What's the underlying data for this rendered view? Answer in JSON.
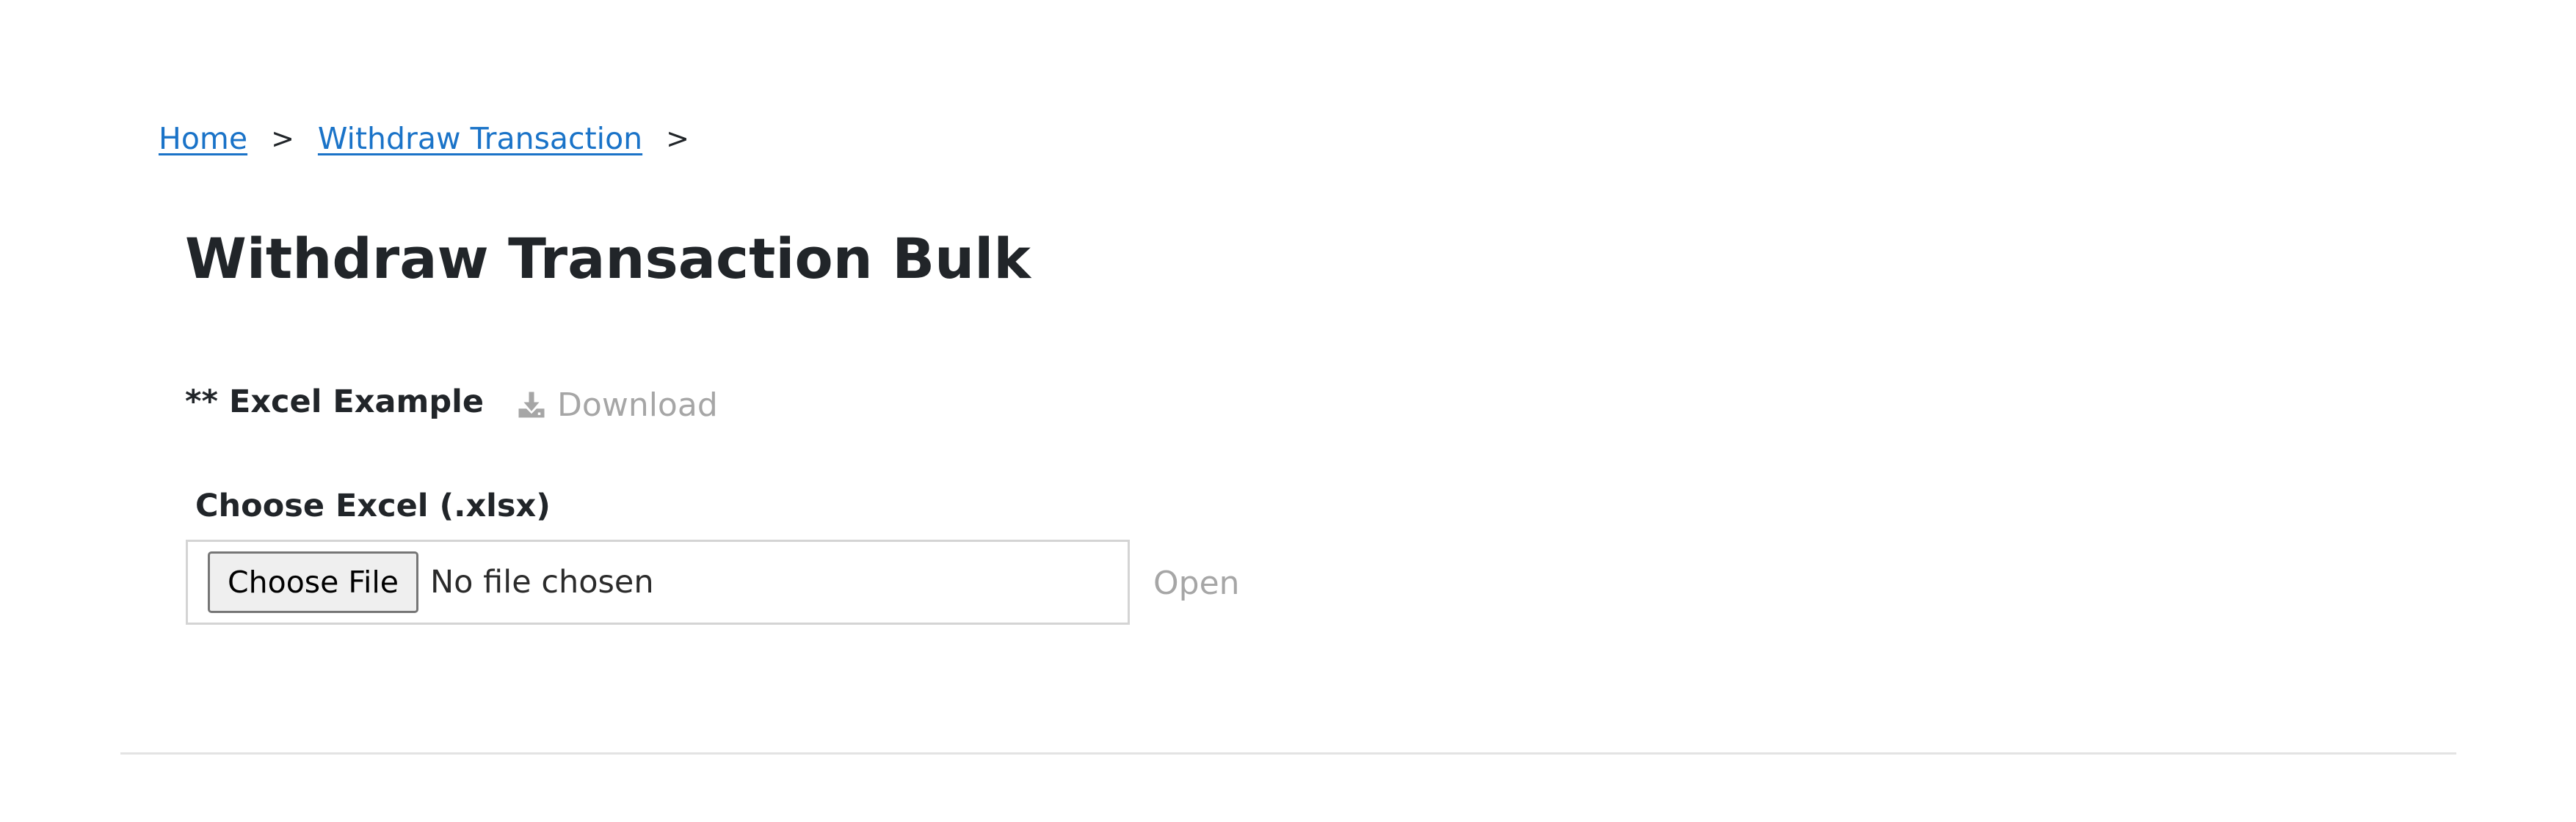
{
  "breadcrumb": {
    "items": [
      {
        "label": "Home"
      },
      {
        "label": "Withdraw Transaction"
      }
    ],
    "separator": ">"
  },
  "page": {
    "title": "Withdraw Transaction Bulk"
  },
  "excel_example": {
    "label": "** Excel Example",
    "download_label": "Download",
    "download_icon": "download-icon"
  },
  "file_upload": {
    "label": "Choose Excel (.xlsx)",
    "button_label": "Choose File",
    "status_text": "No file chosen",
    "open_label": "Open"
  },
  "colors": {
    "link": "#1a73c8",
    "muted": "#a6a6a6",
    "text": "#212529"
  }
}
